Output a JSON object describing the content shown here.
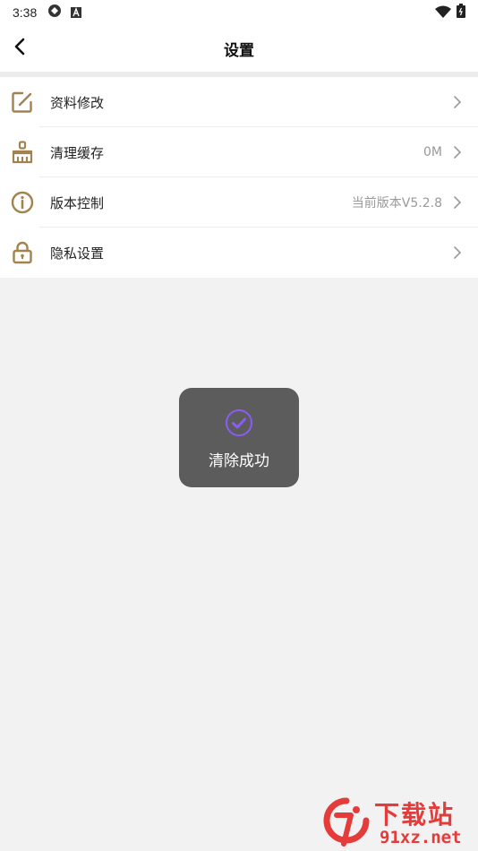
{
  "status_bar": {
    "time": "3:38",
    "left_icons": [
      "sync-icon",
      "a-badge-icon"
    ],
    "right_icons": [
      "wifi-icon",
      "battery-icon"
    ]
  },
  "header": {
    "title": "设置",
    "back_icon": "chevron-left-icon"
  },
  "settings": [
    {
      "label": "资料修改",
      "value": "",
      "icon": "edit-icon"
    },
    {
      "label": "清理缓存",
      "value": "0M",
      "icon": "brush-icon"
    },
    {
      "label": "版本控制",
      "value": "当前版本V5.2.8",
      "icon": "info-icon"
    },
    {
      "label": "隐私设置",
      "value": "",
      "icon": "lock-icon"
    }
  ],
  "toast": {
    "message": "清除成功",
    "icon": "check-circle-icon"
  },
  "watermark": {
    "top": "下载站",
    "bottom": "91xz.net"
  },
  "colors": {
    "accent_icon": "#a3834d",
    "toast_bg": "#5c5c5c",
    "toast_check": "#8a5cf5",
    "watermark": "#e43b3b"
  }
}
